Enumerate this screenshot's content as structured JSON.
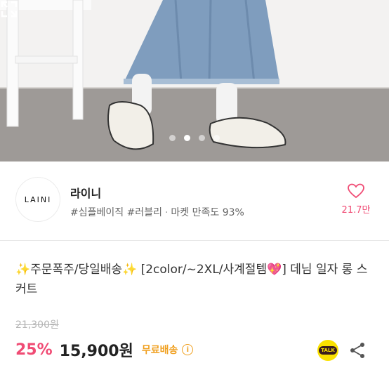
{
  "gallery": {
    "dots": [
      "slide-1",
      "slide-2",
      "slide-3",
      "slide-4"
    ],
    "active_index": 1
  },
  "seller": {
    "logo_text": "LAINI",
    "name": "라이니",
    "tags": "#심플베이직 #러블리",
    "separator": "·",
    "satisfaction": "마켓 만족도 93%",
    "likes": "21.7만"
  },
  "product": {
    "title": "✨주문폭주/당일배송✨ [2color/~2XL/사계절템💖] 데님 일자 롱 스커트",
    "original_price": "21,300원",
    "discount": "25%",
    "price": "15,900원",
    "shipping": "무료배송",
    "info_glyph": "i",
    "talk_label": "TALK"
  },
  "colors": {
    "accent": "#f04b74",
    "shipping": "#f0a020",
    "kakao": "#fae100"
  },
  "icons": [
    "expand-icon",
    "heart-icon",
    "info-icon",
    "kakao-talk-icon",
    "share-icon"
  ]
}
